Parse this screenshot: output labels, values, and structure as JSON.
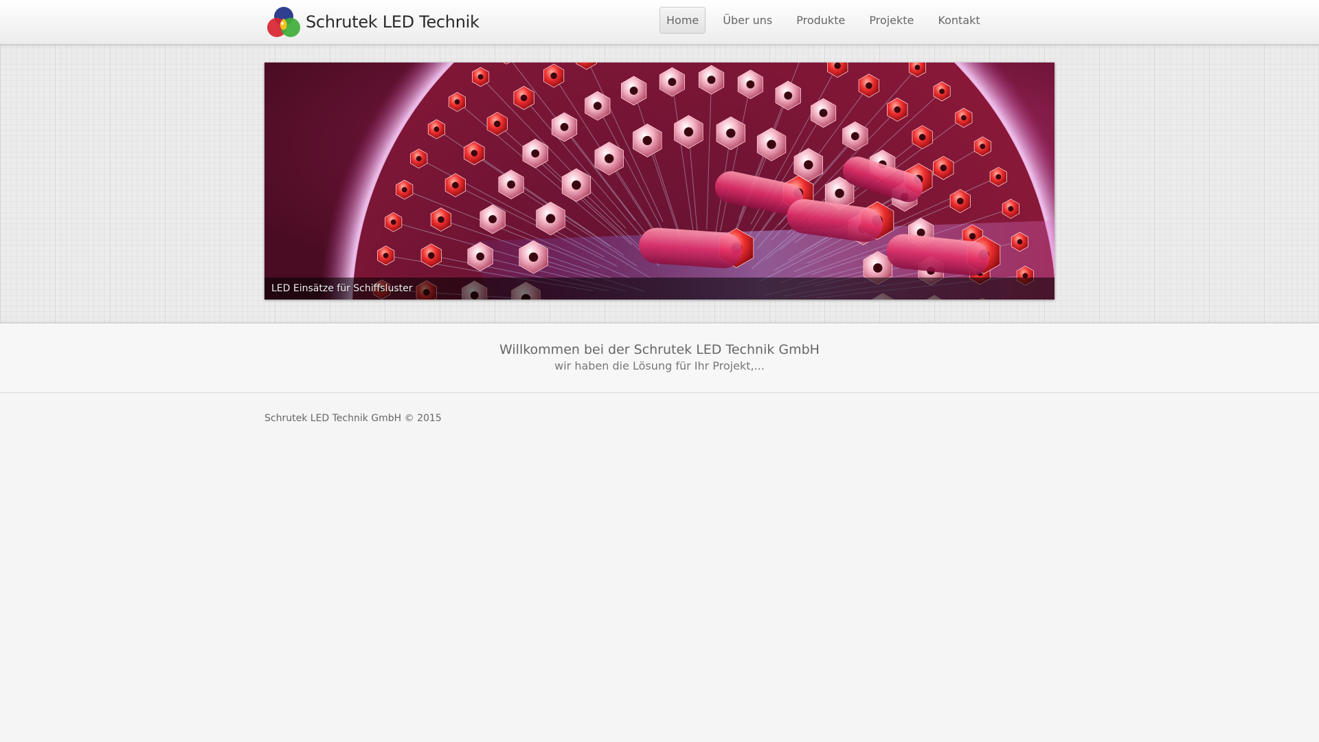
{
  "brand": {
    "name": "Schrutek LED Technik",
    "logo_colors": [
      "#2f3f8f",
      "#d8242f",
      "#3fae3a",
      "#f2c21b"
    ]
  },
  "nav": {
    "items": [
      {
        "label": "Home",
        "active": true
      },
      {
        "label": "Über uns",
        "active": false
      },
      {
        "label": "Produkte",
        "active": false
      },
      {
        "label": "Projekte",
        "active": false
      },
      {
        "label": "Kontakt",
        "active": false
      }
    ]
  },
  "slider": {
    "caption": "LED Einsätze für Schiffsluster"
  },
  "welcome": {
    "title": "Willkommen bei der Schrutek LED Technik GmbH",
    "subtitle": "wir haben die Lösung für Ihr Projekt,..."
  },
  "footer": {
    "copyright": "Schrutek LED Technik GmbH © 2015"
  }
}
